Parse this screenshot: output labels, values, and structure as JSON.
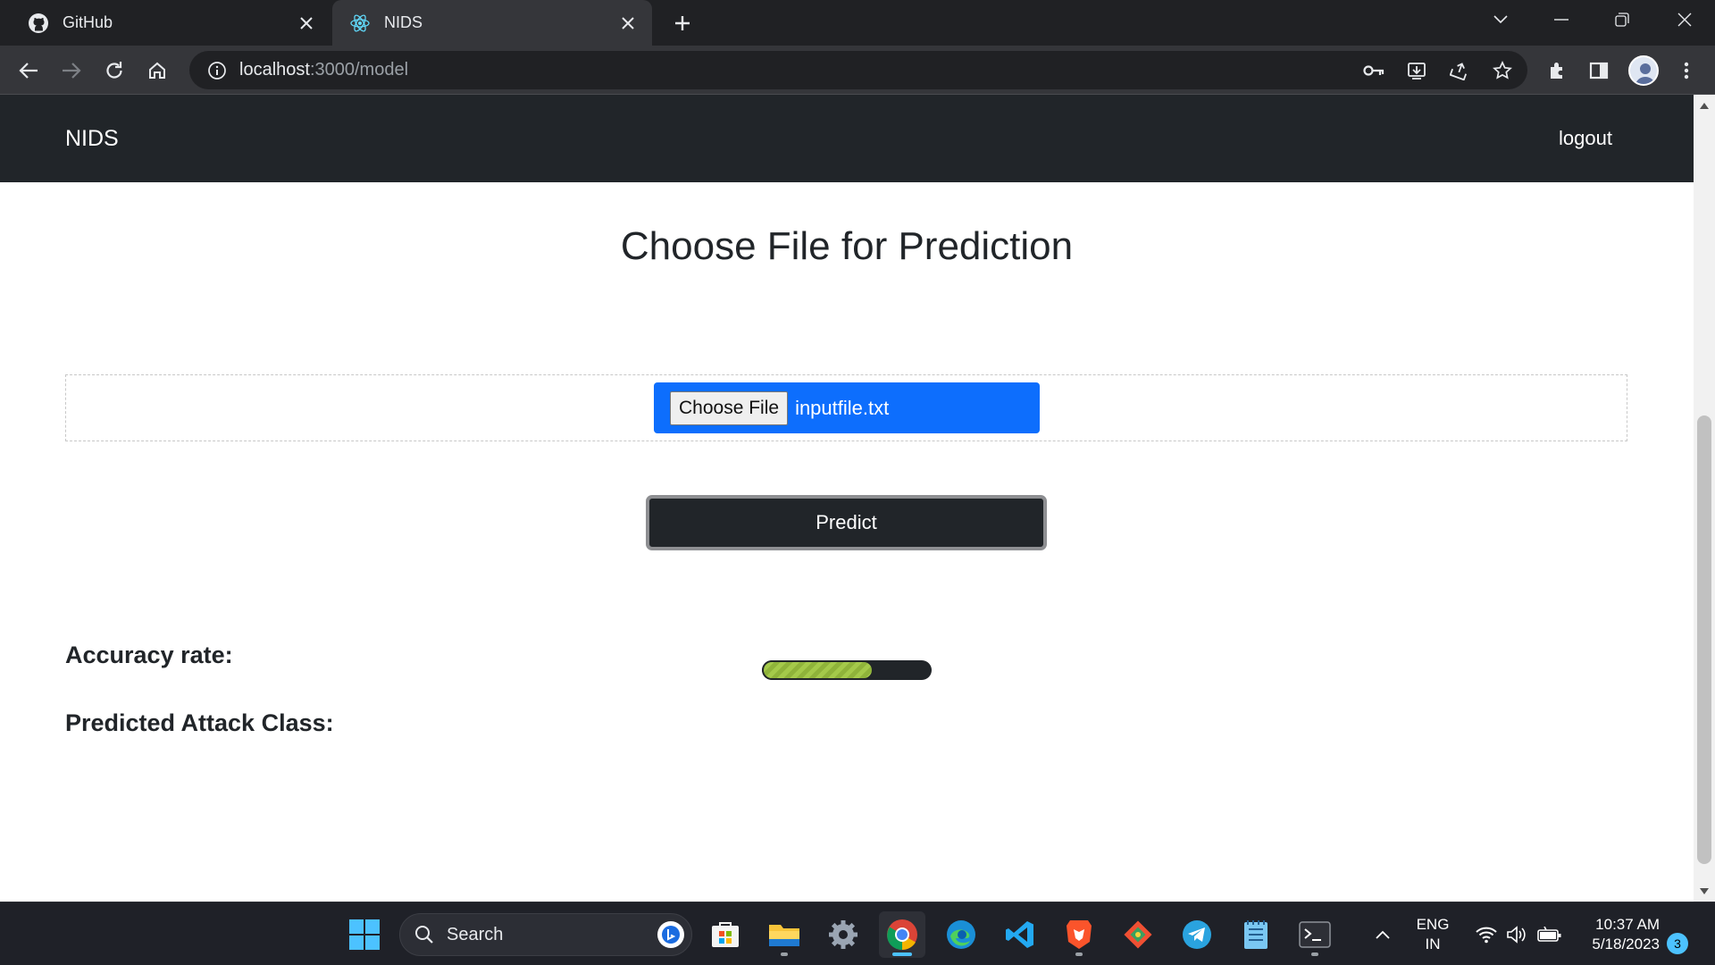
{
  "browser": {
    "tabs": [
      {
        "title": "GitHub",
        "icon": "github-icon"
      },
      {
        "title": "NIDS",
        "icon": "react-icon",
        "active": true
      }
    ],
    "url_host": "localhost",
    "url_path": ":3000/model"
  },
  "navbar": {
    "brand": "NIDS",
    "logout": "logout"
  },
  "page": {
    "heading": "Choose File for Prediction",
    "file_button": "Choose File",
    "file_name": "inputfile.txt",
    "predict_label": "Predict",
    "progress_fraction": 0.66,
    "accuracy_label": "Accuracy rate:",
    "attack_label": "Predicted Attack Class:"
  },
  "colors": {
    "navbar_bg": "#212529",
    "file_input_bg": "#0d6efd",
    "progress_fill": "#a4c94a"
  },
  "taskbar": {
    "search_placeholder": "Search",
    "language_line1": "ENG",
    "language_line2": "IN",
    "time": "10:37 AM",
    "date": "5/18/2023",
    "notification_count": "3"
  }
}
